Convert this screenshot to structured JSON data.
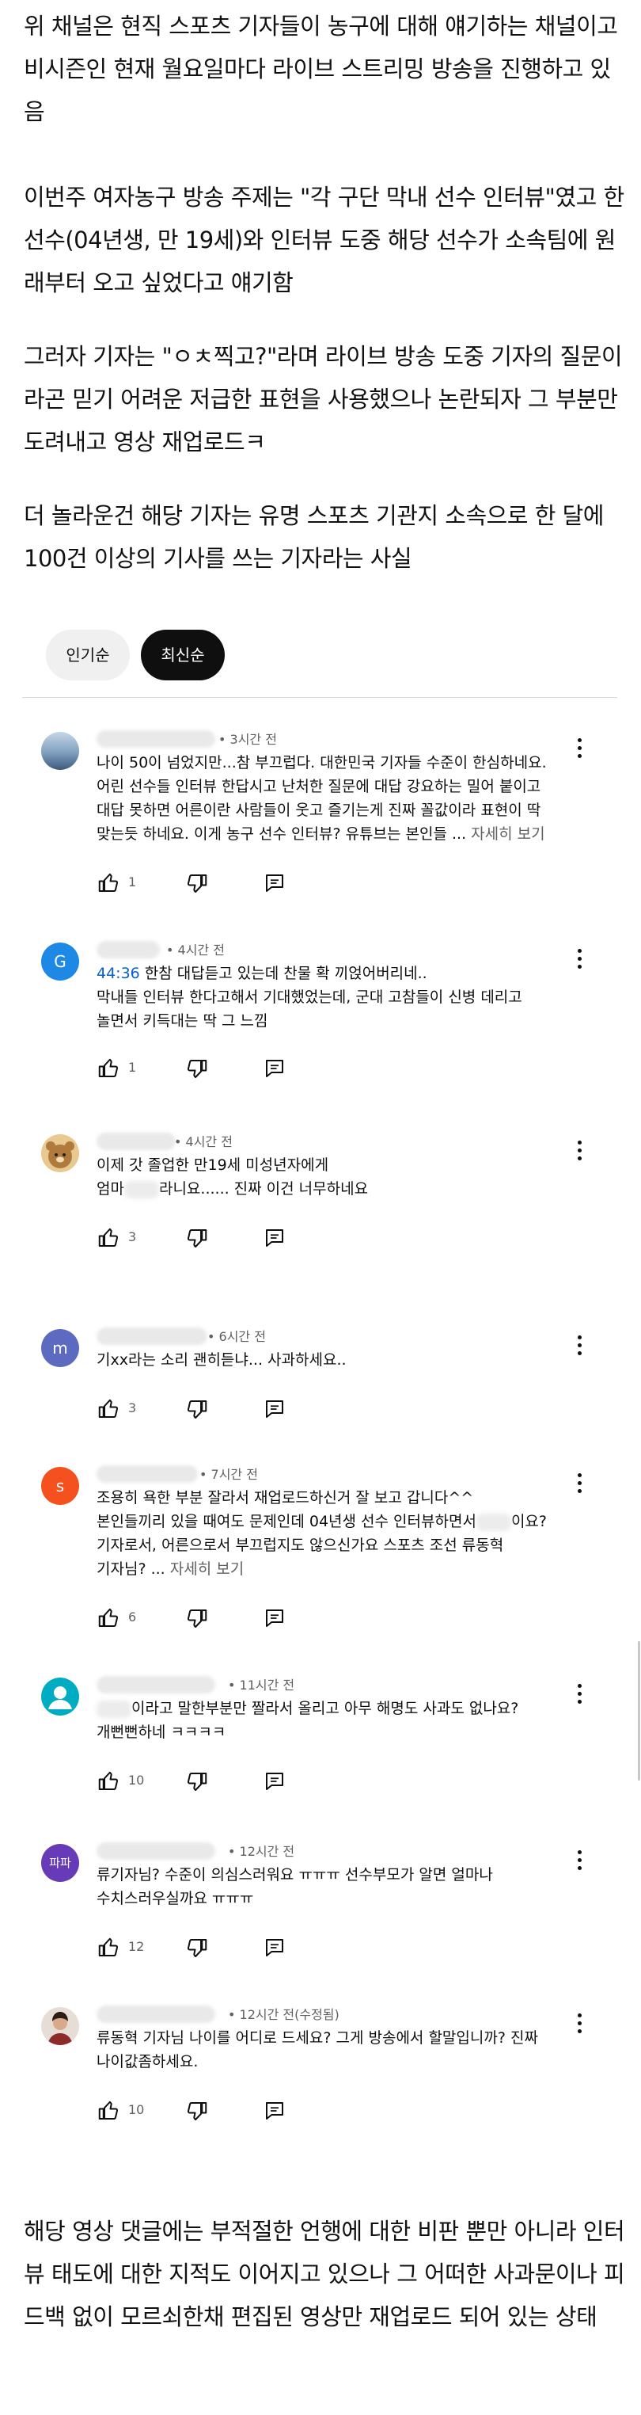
{
  "intro": {
    "para1": "위 채널은 현직 스포츠 기자들이 농구에 대해 얘기하는 채널이고 비시즌인 현재 월요일마다 라이브 스트리밍 방송을 진행하고 있음",
    "para2": "이번주 여자농구 방송 주제는 \"각 구단 막내 선수 인터뷰\"였고 한 선수(04년생, 만 19세)와 인터뷰 도중 해당 선수가 소속팀에 원래부터 오고 싶었다고 얘기함",
    "para3": "그러자 기자는 \"ㅇㅊ찍고?\"라며 라이브 방송 도중 기자의 질문이라곤 믿기 어려운 저급한 표현을 사용했으나 논란되자 그 부분만 도려내고 영상 재업로드ㅋ",
    "para4": "더 놀라운건 해당 기자는 유명 스포츠 기관지 소속으로 한 달에 100건 이상의 기사를 쓰는 기자라는 사실"
  },
  "sort": {
    "popular": "인기순",
    "newest": "최신순"
  },
  "comments": [
    {
      "time": "• 3시간 전",
      "avatar_letter": "",
      "avatar_color": "#5b7fa6",
      "lines": [
        "나이 50이 넘었지만...참 부끄럽다. 대한민국 기자들 수준이 한심하네요.",
        "어린 선수들 인터뷰 한답시고 난처한 질문에 대답 강요하는 밀어 붙이고",
        "대답 못하면 어른이란 사람들이 웃고 즐기는게 진짜 꼴값이라 표현이 딱",
        "맞는듯 하네요. 이게 농구 선수 인터뷰? 유튜브는 본인들 ..."
      ],
      "more": "자세히 보기",
      "likes": "1"
    },
    {
      "time": "• 4시간 전",
      "avatar_letter": "G",
      "avatar_color": "#1e88e5",
      "timestamp": "44:36",
      "lines": [
        " 한참 대답듣고 있는데 찬물 확 끼얹어버리네..",
        "막내들 인터뷰 한다고해서 기대했었는데,  군대 고참들이 신병 데리고",
        "놀면서 키득대는 딱 그 느낌"
      ],
      "likes": "1"
    },
    {
      "time": "• 4시간 전",
      "avatar_letter": "",
      "avatar_color": "#c9a063",
      "lines": [
        "이제 갓 졸업한 만19세 미성년자에게",
        "엄마",
        "라니요......  진짜 이건 너무하네요"
      ],
      "likes": "3"
    },
    {
      "time": "• 6시간 전",
      "avatar_letter": "m",
      "avatar_color": "#5c6bc0",
      "lines": [
        "기xx라는 소리 괜히듣냐... 사과하세요.."
      ],
      "likes": "3"
    },
    {
      "time": "• 7시간 전",
      "avatar_letter": "s",
      "avatar_color": "#f4511e",
      "lines": [
        "조용히 욕한 부분 잘라서 재업로드하신거 잘 보고 갑니다^^",
        "본인들끼리 있을 때여도 문제인데 04년생 선수 인터뷰하면서",
        "이요?",
        "기자로서, 어른으로서 부끄럽지도 않으신가요 스포츠 조선 류동혁",
        "기자님? ..."
      ],
      "more": "자세히 보기",
      "likes": "6"
    },
    {
      "time": "• 11시간 전",
      "avatar_letter": "",
      "avatar_color": "#00acc1",
      "lines": [
        "이라고 말한부분만 짤라서 올리고 아무 해명도 사과도 없나요?",
        "개뻔뻔하네 ㅋㅋㅋㅋ"
      ],
      "likes": "10"
    },
    {
      "time": "• 12시간 전",
      "avatar_letter": "파파",
      "avatar_color": "#673ab7",
      "lines": [
        "류기자님? 수준이 의심스러워요 ㅠㅠㅠ 선수부모가 알면 얼마나",
        "수치스러우실까요 ㅠㅠㅠ"
      ],
      "likes": "12"
    },
    {
      "time": "• 12시간 전(수정됨)",
      "avatar_letter": "",
      "avatar_color": "#3e2723",
      "lines": [
        "류동혁 기자님 나이를 어디로 드세요? 그게 방송에서 할말입니까? 진짜",
        "나이값좀하세요."
      ],
      "likes": "10"
    }
  ],
  "outro": "해당 영상 댓글에는 부적절한 언행에 대한 비판 뿐만 아니라 인터뷰 태도에 대한 지적도 이어지고 있으나 그 어떠한 사과문이나 피드백 없이 모르쇠한채 편집된 영상만 재업로드 되어 있는 상태"
}
